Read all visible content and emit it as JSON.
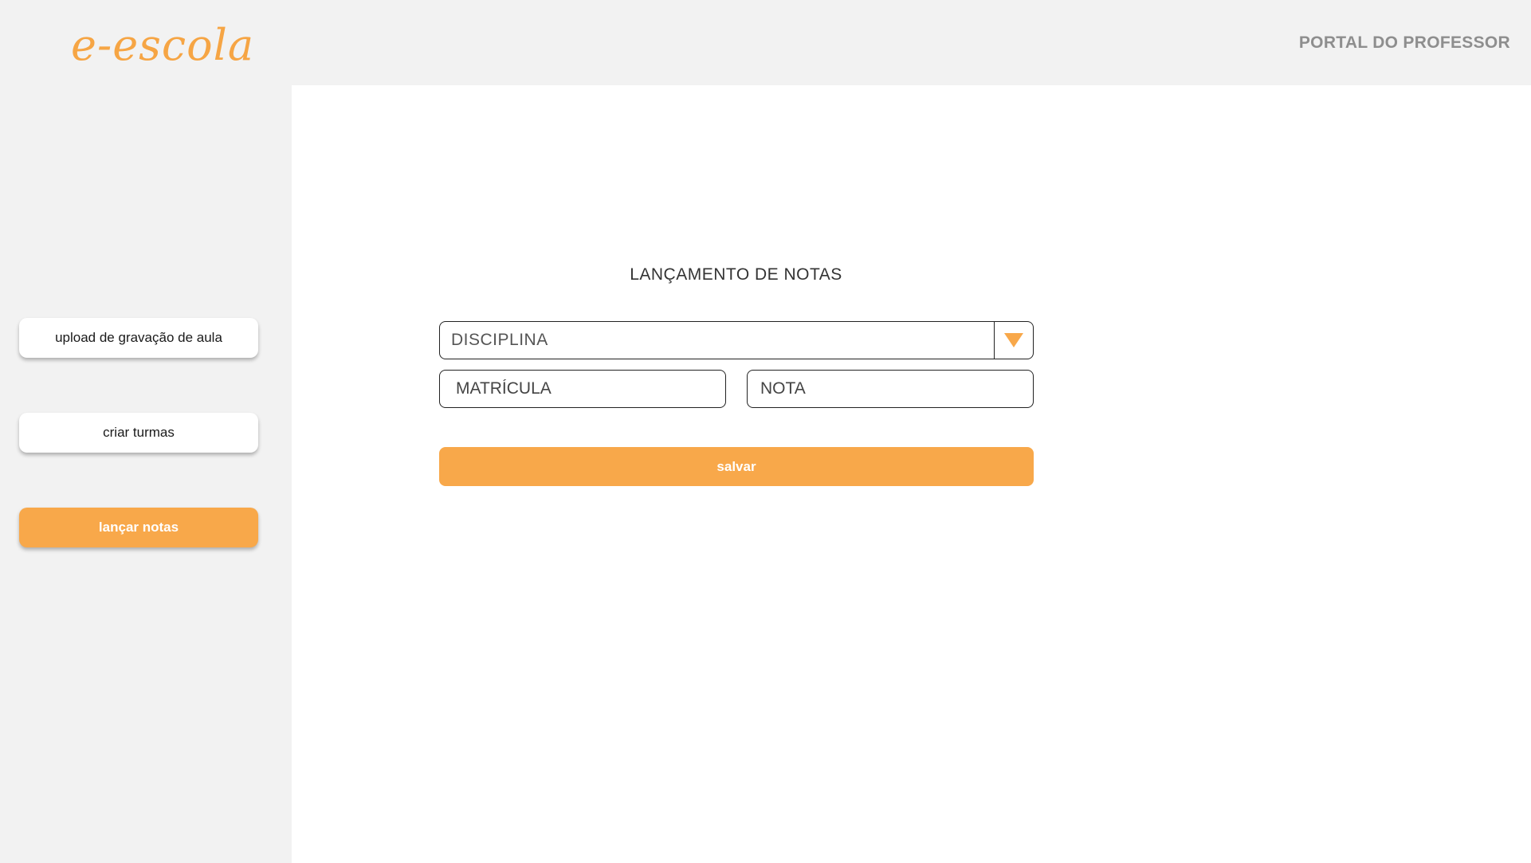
{
  "brand": {
    "logo_text": "e-escola"
  },
  "header": {
    "portal_title": "PORTAL DO PROFESSOR"
  },
  "sidebar": {
    "items": [
      {
        "label": "upload de gravação de aula",
        "active": false
      },
      {
        "label": "criar turmas",
        "active": false
      },
      {
        "label": "lançar notas",
        "active": true
      }
    ]
  },
  "form": {
    "title": "LANÇAMENTO DE NOTAS",
    "discipline_select": {
      "value": "DISCIPLINA"
    },
    "enrollment_field": {
      "placeholder": "MATRÍCULA"
    },
    "grade_field": {
      "placeholder": "NOTA"
    },
    "save_label": "salvar"
  },
  "colors": {
    "accent": "#f8a84a",
    "chrome_bg": "#f2f2f2",
    "content_bg": "#ffffff"
  }
}
